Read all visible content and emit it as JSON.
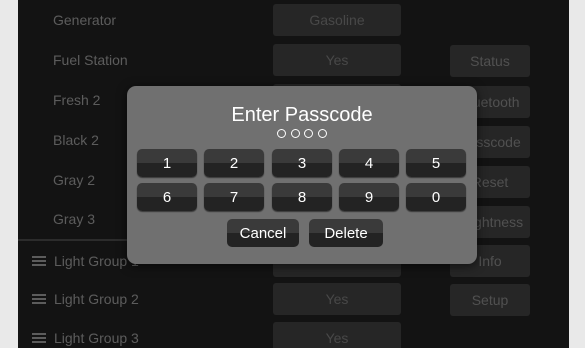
{
  "settings": {
    "rows": [
      {
        "label": "Generator",
        "value": "Gasoline"
      },
      {
        "label": "Fuel Station",
        "value": "Yes"
      },
      {
        "label": "Fresh 2",
        "value": ""
      },
      {
        "label": "Black 2",
        "value": ""
      },
      {
        "label": "Gray 2",
        "value": ""
      },
      {
        "label": "Gray 3",
        "value": ""
      }
    ],
    "light_rows": [
      {
        "label": "Light Group 1",
        "value": ""
      },
      {
        "label": "Light Group 2",
        "value": "Yes"
      },
      {
        "label": "Light Group 3",
        "value": "Yes"
      }
    ]
  },
  "side_menu": {
    "items": [
      "Status",
      "Bluetooth",
      "Passcode",
      "Reset",
      "Brightness",
      "Info",
      "Setup"
    ]
  },
  "passcode_dialog": {
    "title": "Enter Passcode",
    "entered_digits": 0,
    "total_digits": 4,
    "keys": [
      "1",
      "2",
      "3",
      "4",
      "5",
      "6",
      "7",
      "8",
      "9",
      "0"
    ],
    "cancel_label": "Cancel",
    "delete_label": "Delete"
  }
}
